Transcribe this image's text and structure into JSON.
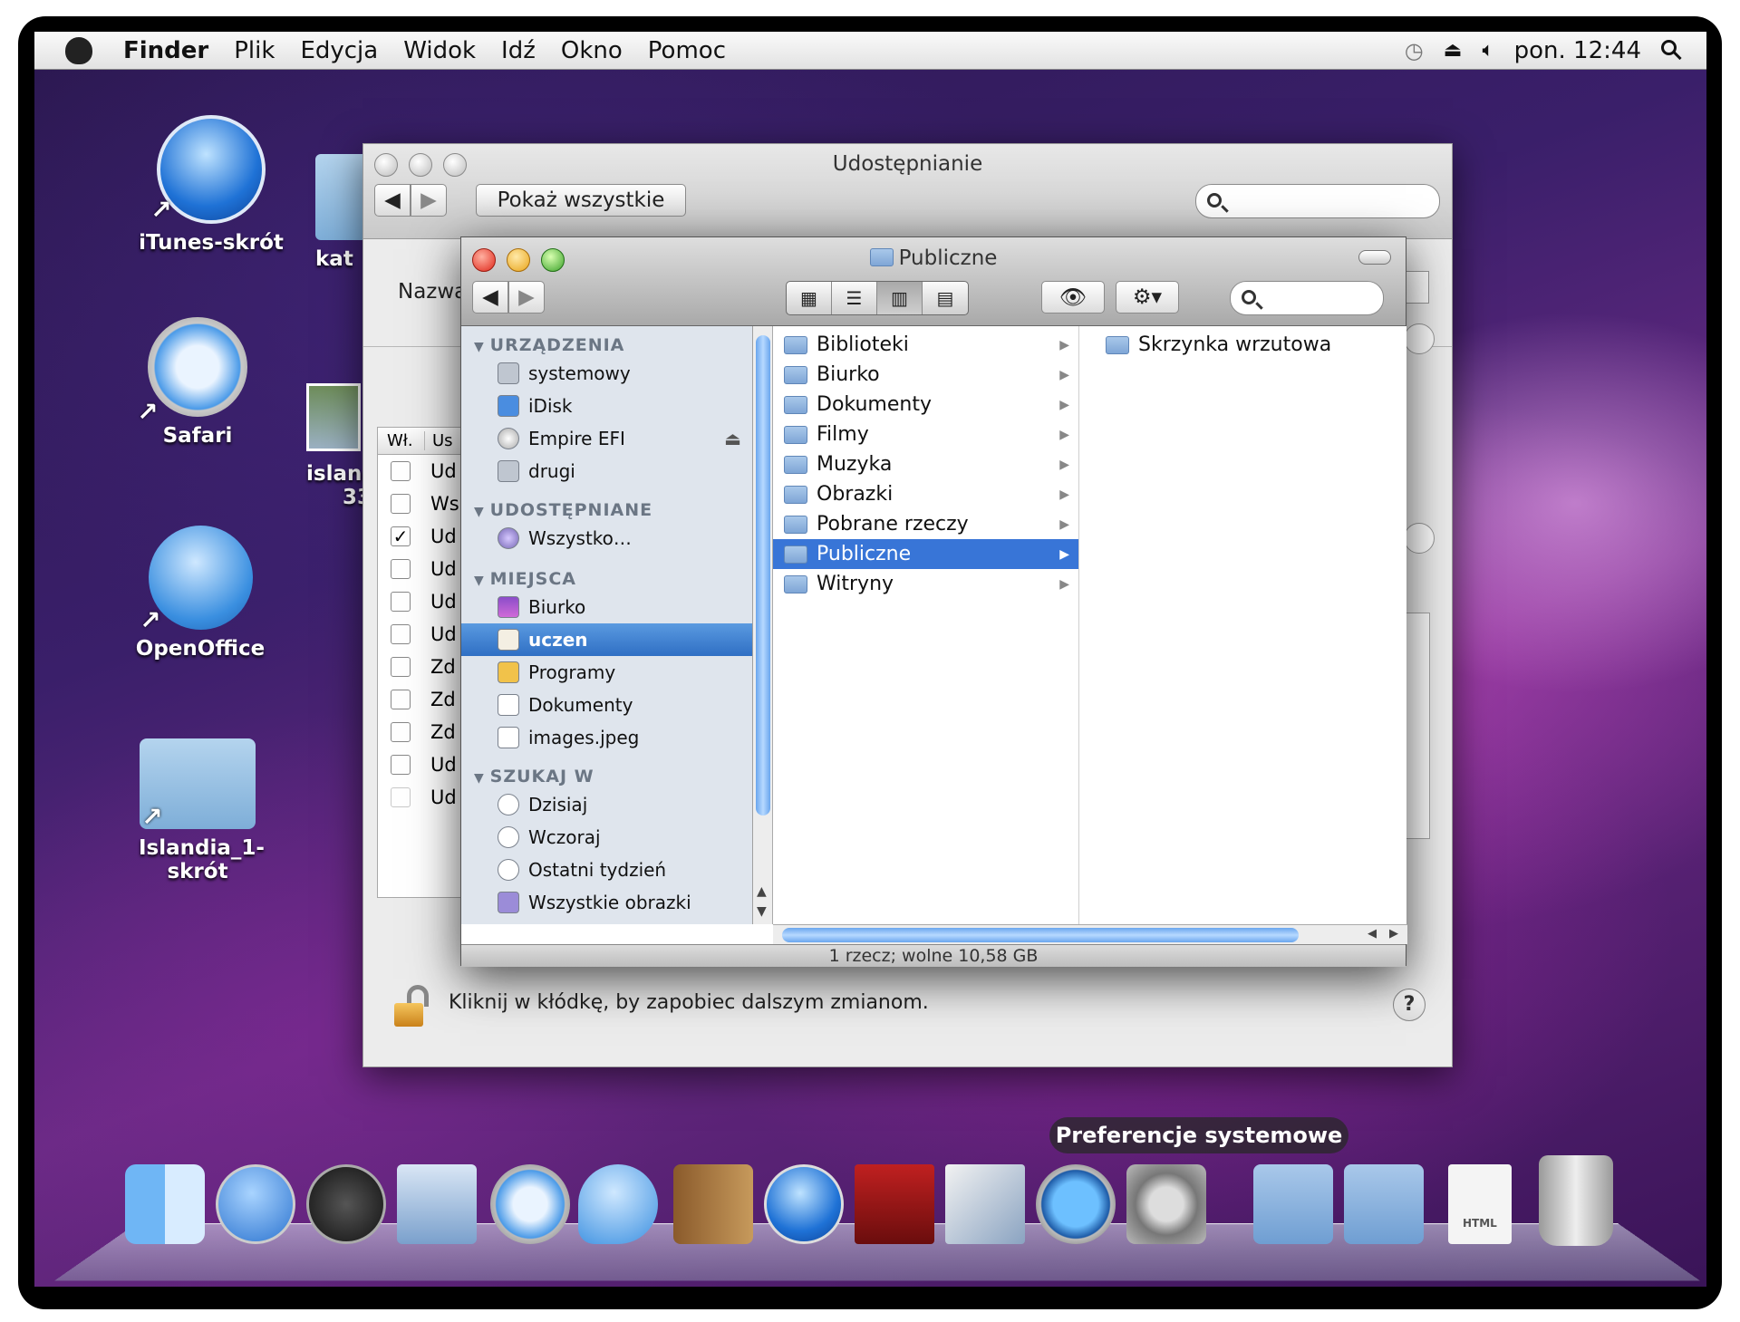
{
  "menubar": {
    "app": "Finder",
    "items": [
      "Plik",
      "Edycja",
      "Widok",
      "Idź",
      "Okno",
      "Pomoc"
    ],
    "clock": "pon. 12:44"
  },
  "desktop": {
    "icons": [
      "iTunes-skrót",
      "Safari",
      "OpenOffice",
      "Islandia_1-skrót"
    ],
    "partial": [
      "kat",
      "island",
      "33"
    ]
  },
  "prefs": {
    "title": "Udostępnianie",
    "show_all": "Pokaż wszystkie",
    "name_label": "Nazwa",
    "col_owner": "Wł.",
    "col_user": "Us",
    "rows": [
      "Ud",
      "Ws",
      "Ud",
      "Ud",
      "Ud",
      "Ud",
      "Zd",
      "Zd",
      "Zd",
      "Ud",
      "Ud"
    ],
    "lock_text": "Kliknij w kłódkę, by zapobiec dalszym zmianom.",
    "help": "?"
  },
  "finder": {
    "title": "Publiczne",
    "sections": {
      "devices": {
        "label": "URZĄDZENIA",
        "items": [
          "systemowy",
          "iDisk",
          "Empire EFI",
          "drugi"
        ]
      },
      "shared": {
        "label": "UDOSTĘPNIANE",
        "items": [
          "Wszystko…"
        ]
      },
      "places": {
        "label": "MIEJSCA",
        "items": [
          "Biurko",
          "uczen",
          "Programy",
          "Dokumenty",
          "images.jpeg"
        ]
      },
      "search": {
        "label": "SZUKAJ W",
        "items": [
          "Dzisiaj",
          "Wczoraj",
          "Ostatni tydzień",
          "Wszystkie obrazki"
        ]
      }
    },
    "col1": [
      "Biblioteki",
      "Biurko",
      "Dokumenty",
      "Filmy",
      "Muzyka",
      "Obrazki",
      "Pobrane rzeczy",
      "Publiczne",
      "Witryny"
    ],
    "col2": [
      "Skrzynka wrzutowa"
    ],
    "status": "1 rzecz; wolne 10,58 GB"
  },
  "dock": {
    "tooltip": "Preferencje systemowe",
    "html_label": "HTML"
  }
}
